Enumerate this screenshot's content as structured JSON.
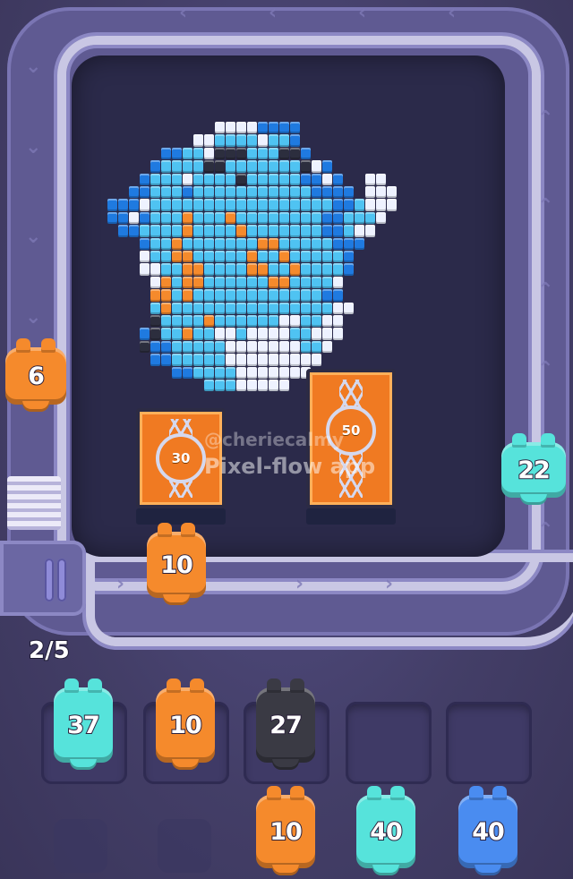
{
  "game": {
    "watermark_top": "@cheriecalmy",
    "watermark_main": "Pixel-flow app",
    "queue_counter": "2/5"
  },
  "targets": [
    {
      "value": "30"
    },
    {
      "value": "50"
    }
  ],
  "conveyor_creatures": [
    {
      "value": "6",
      "color": "orange"
    },
    {
      "value": "10",
      "color": "orange"
    },
    {
      "value": "22",
      "color": "cyan"
    }
  ],
  "slots": [
    {
      "value": "37",
      "color": "cyan"
    },
    {
      "value": "10",
      "color": "orange"
    },
    {
      "value": "27",
      "color": "black"
    },
    {
      "value": "",
      "color": "empty"
    },
    {
      "value": "",
      "color": "empty"
    }
  ],
  "reserve": [
    {
      "value": "10",
      "color": "orange"
    },
    {
      "value": "40",
      "color": "cyan"
    },
    {
      "value": "40",
      "color": "blue"
    }
  ],
  "colors": {
    "orange": "#f58a2c",
    "cyan": "#56e3db",
    "black": "#3a3a44",
    "blue": "#4a8cf0",
    "light_blue": "#4fc3f2",
    "deep_blue": "#1f7ae0",
    "white": "#eef2ff",
    "dark": "#2c2e3e"
  }
}
